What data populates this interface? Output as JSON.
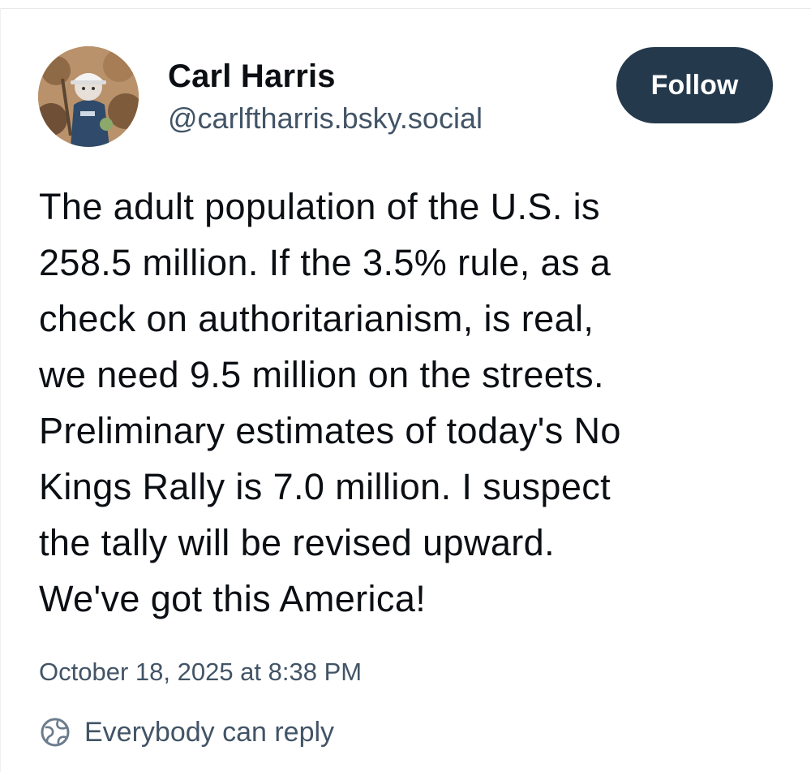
{
  "author": {
    "display_name": "Carl Harris",
    "handle": "@carlftharris.bsky.social",
    "avatar_icon": "profile-photo"
  },
  "follow_label": "Follow",
  "post": {
    "text": "The adult population of the U.S. is\n258.5 million.  If the 3.5% rule, as a\ncheck on authoritarianism, is real,\nwe need  9.5 million on the streets.\nPreliminary estimates  of today's No\nKings Rally is 7.0 million.  I suspect\nthe tally will be revised upward.\nWe've got this America!",
    "timestamp": "October 18, 2025 at 8:38 PM",
    "reply_setting_label": "Everybody can reply",
    "reply_setting_icon": "earth-icon"
  },
  "colors": {
    "follow_bg": "#25394c",
    "muted_text": "#425466",
    "text": "#0b0f14"
  }
}
